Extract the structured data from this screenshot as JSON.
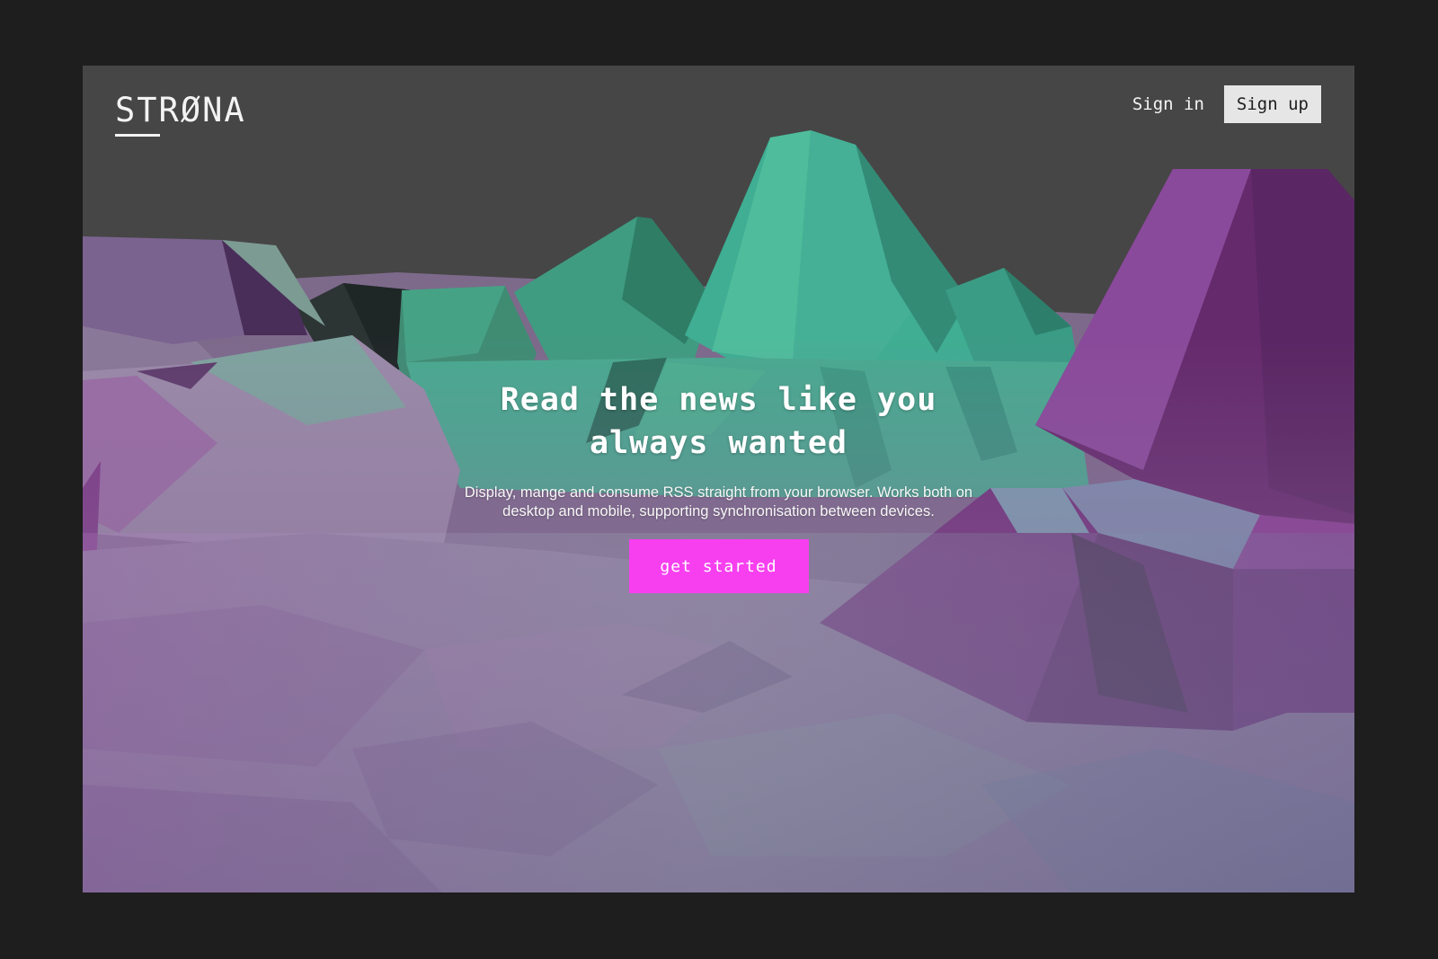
{
  "brand": {
    "logo_text": "STRØNA"
  },
  "nav": {
    "sign_in": "Sign in",
    "sign_up": "Sign up"
  },
  "hero": {
    "title": "Read the news like you always wanted",
    "description": "Display, mange  and consume RSS straight from your browser. Works both on desktop and mobile, supporting synchronisation between devices.",
    "cta_label": "get started"
  },
  "colors": {
    "page_background": "#1e1e1e",
    "sky": "#464646",
    "accent_cta": "#f73ff0",
    "mint": "#47ad92",
    "purple": "#7a2f7c",
    "sign_up_button": "#e6e6e6"
  }
}
